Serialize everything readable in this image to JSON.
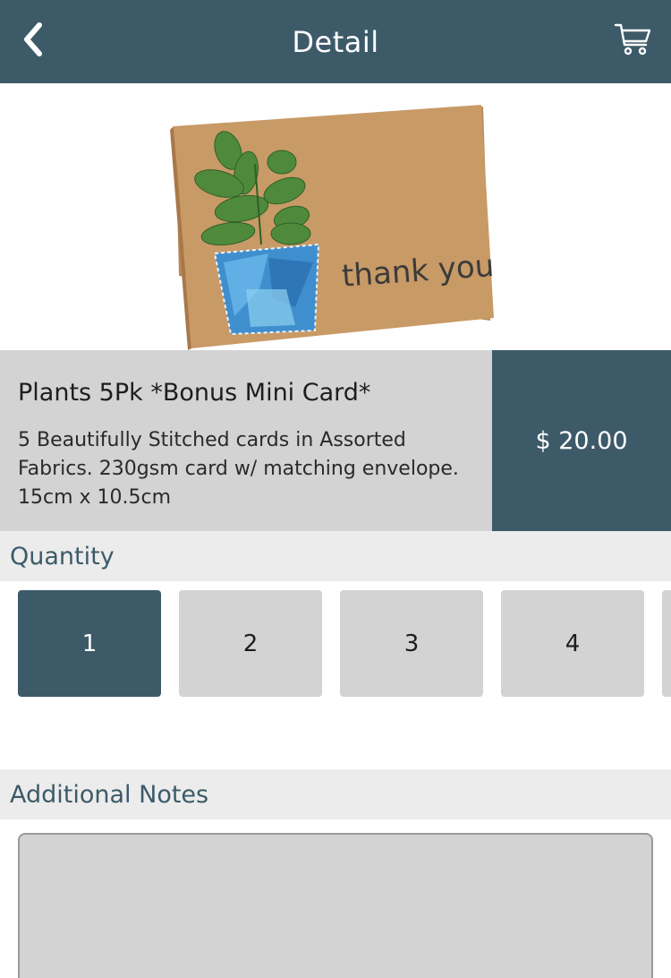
{
  "header": {
    "title": "Detail",
    "back_icon": "chevron-left-icon",
    "cart_icon": "cart-icon",
    "color": "#3d5a69"
  },
  "hero": {
    "card_text": "thank you"
  },
  "product": {
    "name": "Plants 5Pk *Bonus Mini Card*",
    "description": "5 Beautifully Stitched cards in Assorted Fabrics. 230gsm card w/ matching envelope. 15cm x 10.5cm",
    "price": "$ 20.00"
  },
  "quantity": {
    "label": "Quantity",
    "options": [
      "1",
      "2",
      "3",
      "4"
    ],
    "selected": "1"
  },
  "notes": {
    "label": "Additional Notes",
    "value": ""
  }
}
